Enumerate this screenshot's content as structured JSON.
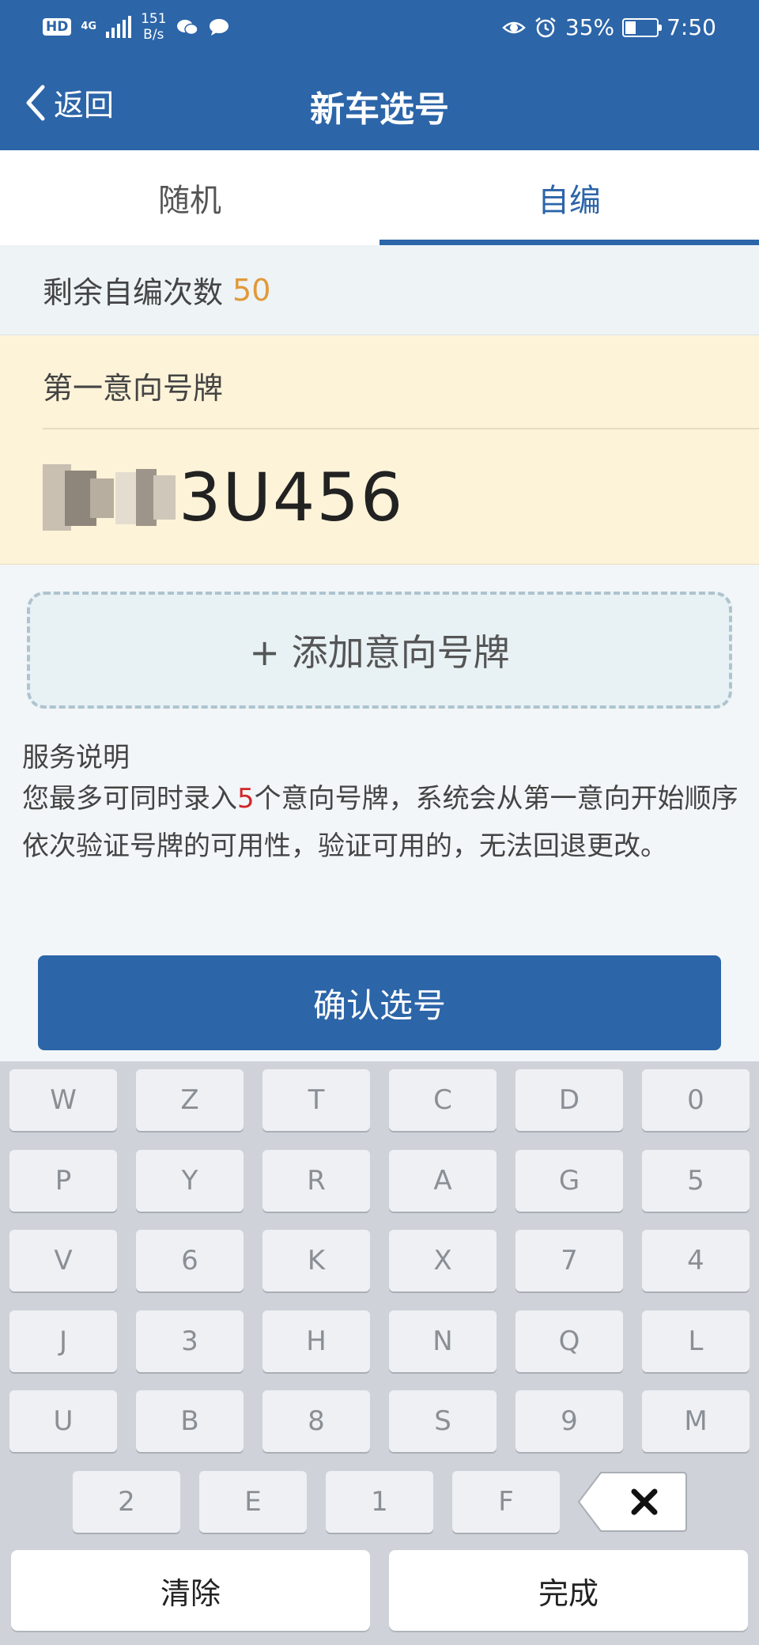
{
  "status_bar": {
    "hd_badge": "HD",
    "network": "4G",
    "speed_value": "151",
    "speed_unit": "B/s",
    "battery_percent": "35%",
    "battery_level": 0.35,
    "time": "7:50"
  },
  "navbar": {
    "back_label": "返回",
    "title": "新车选号"
  },
  "tabs": [
    {
      "label": "随机",
      "active": false
    },
    {
      "label": "自编",
      "active": true
    }
  ],
  "remaining": {
    "label": "剩余自编次数",
    "count": "50"
  },
  "plate_card": {
    "label": "第一意向号牌",
    "plate_suffix": "3U456"
  },
  "add_plate_label": "+ 添加意向号牌",
  "service": {
    "title": "服务说明",
    "text_before": "您最多可同时录入",
    "highlight": "5",
    "text_after": "个意向号牌，系统会从第一意向开始顺序依次验证号牌的可用性，验证可用的，无法回退更改。"
  },
  "confirm_label": "确认选号",
  "keyboard": {
    "rows": [
      [
        "W",
        "Z",
        "T",
        "C",
        "D",
        "0"
      ],
      [
        "P",
        "Y",
        "R",
        "A",
        "G",
        "5"
      ],
      [
        "V",
        "6",
        "K",
        "X",
        "7",
        "4"
      ],
      [
        "J",
        "3",
        "H",
        "N",
        "Q",
        "L"
      ],
      [
        "U",
        "B",
        "8",
        "S",
        "9",
        "M"
      ],
      [
        "2",
        "E",
        "1",
        "F"
      ]
    ],
    "clear_label": "清除",
    "done_label": "完成"
  },
  "colors": {
    "primary": "#2c65a8",
    "count_accent": "#e09a3a",
    "highlight_red": "#d0282c",
    "plate_bg": "#fdf3d8"
  }
}
